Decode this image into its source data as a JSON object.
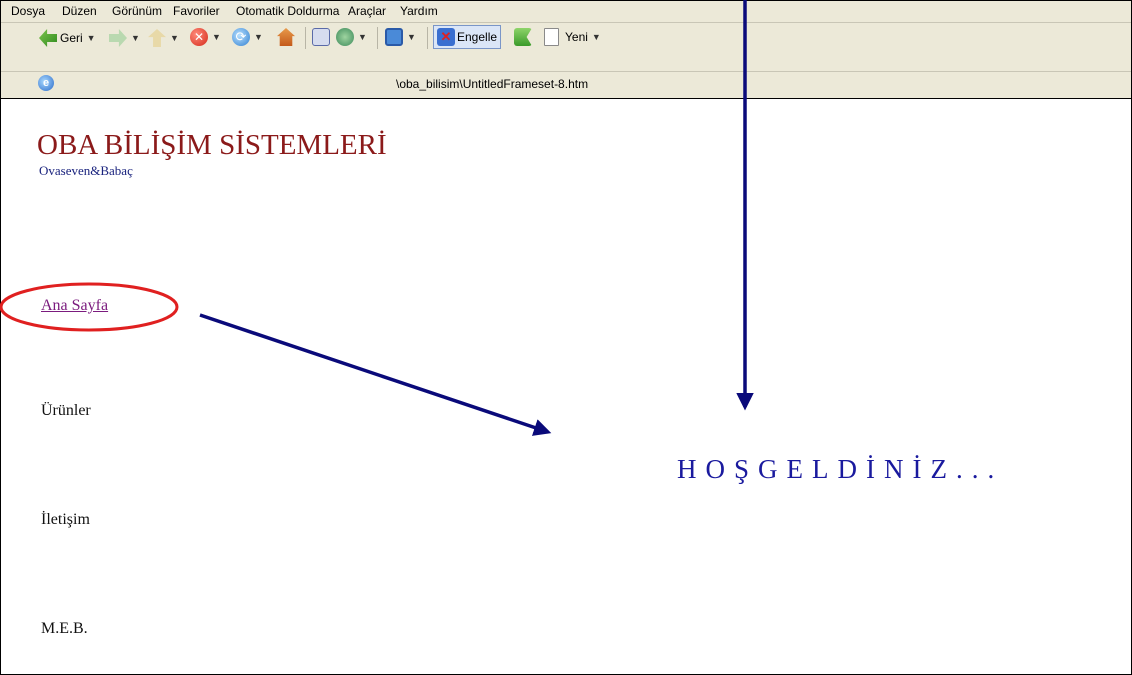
{
  "menu": [
    "Dosya",
    "Düzen",
    "Görünüm",
    "Favoriler",
    "Otomatik Doldurma",
    "Araçlar",
    "Yardım"
  ],
  "toolbar": {
    "back_label": "Geri",
    "block_label": "Engelle",
    "new_label": "Yeni"
  },
  "address": {
    "path": "\\oba_bilisim\\UntitledFrameset-8.htm"
  },
  "page": {
    "title": "OBA BİLİŞİM SİSTEMLERİ",
    "subtitle": "Ovaseven&Babaç",
    "nav": [
      "Ana Sayfa",
      "Ürünler",
      "İletişim",
      "M.E.B."
    ],
    "welcome": "HOŞGELDİNİZ..."
  },
  "colors": {
    "title": "#8b1a1a",
    "subtitle": "#1a237e",
    "link": "#7b1b7e",
    "welcome": "#1a1a9e",
    "annotation_arrow": "#0a0a7a",
    "annotation_circle": "#e02020"
  }
}
